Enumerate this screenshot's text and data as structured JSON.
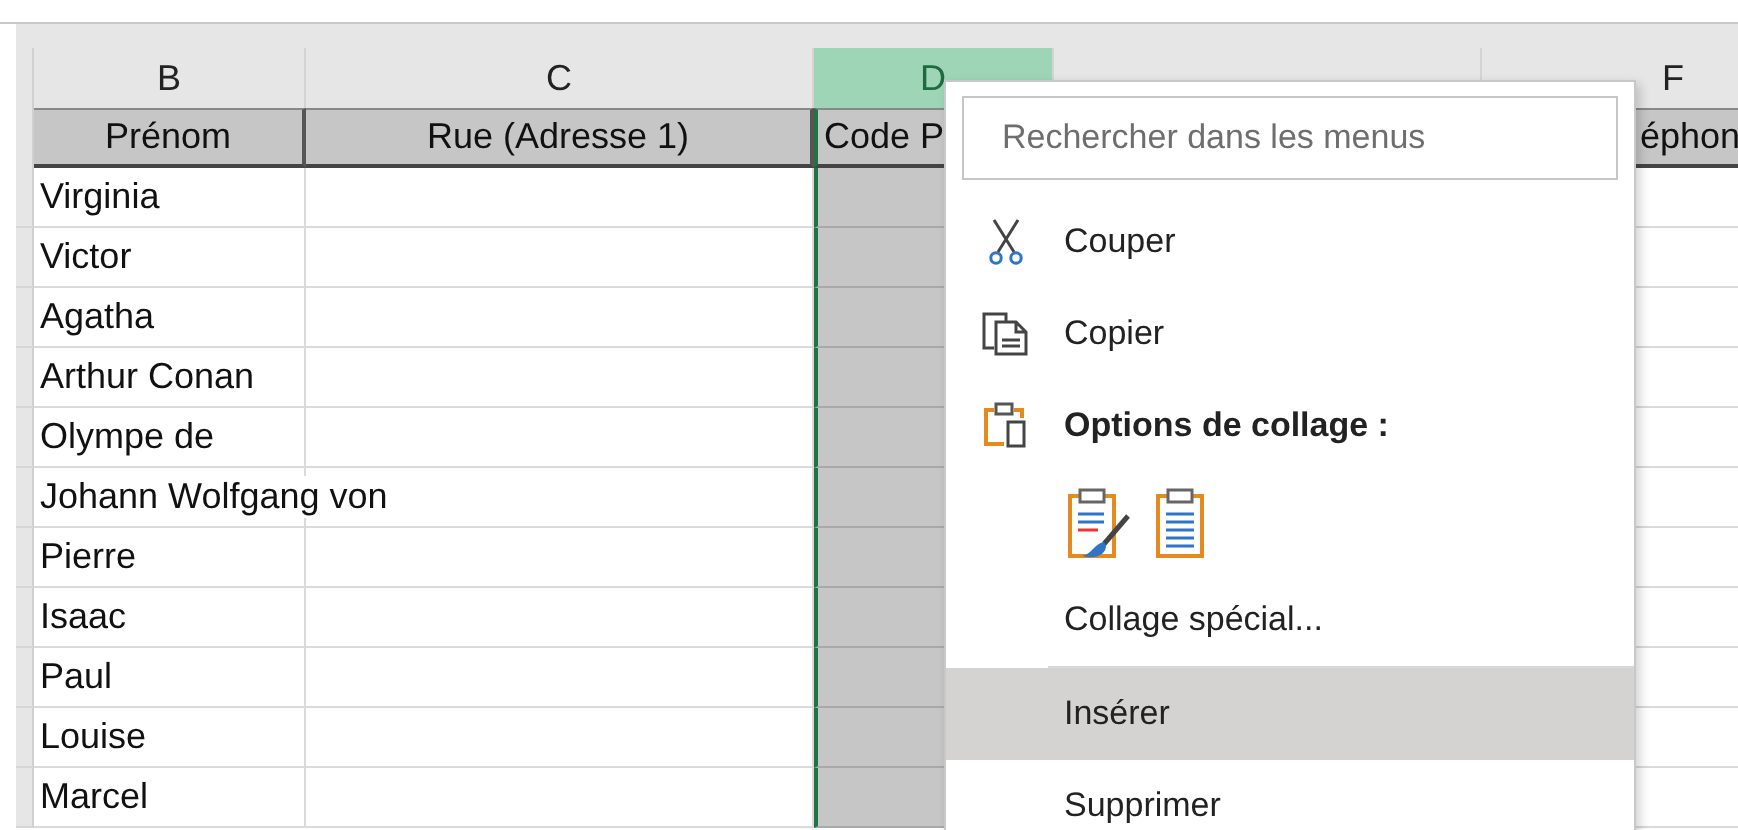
{
  "columns": [
    {
      "letter": "B",
      "selected": false,
      "header": "Prénom"
    },
    {
      "letter": "C",
      "selected": false,
      "header": "Rue (Adresse 1)"
    },
    {
      "letter": "D",
      "selected": true,
      "header": "Code P"
    },
    {
      "selected": false
    },
    {
      "letter": "F",
      "selected": false,
      "header": "éphon"
    }
  ],
  "rows": [
    "Virginia",
    "Victor",
    "Agatha",
    "Arthur Conan",
    "Olympe de",
    "Johann Wolfgang von",
    "Pierre",
    "Isaac",
    "Paul",
    "Louise",
    "Marcel"
  ],
  "context_menu": {
    "search": {
      "placeholder": "Rechercher dans les menus"
    },
    "items": [
      {
        "kind": "command",
        "label": "Couper",
        "highlighted": false
      },
      {
        "kind": "command",
        "label": "Copier",
        "highlighted": false
      },
      {
        "kind": "section",
        "label": "Options de collage :"
      },
      {
        "kind": "paste_options"
      },
      {
        "kind": "command",
        "label": "Collage spécial...",
        "highlighted": false
      },
      {
        "kind": "separator"
      },
      {
        "kind": "command",
        "label": "Insérer",
        "highlighted": true
      },
      {
        "kind": "command",
        "label": "Supprimer",
        "highlighted": false
      }
    ]
  }
}
